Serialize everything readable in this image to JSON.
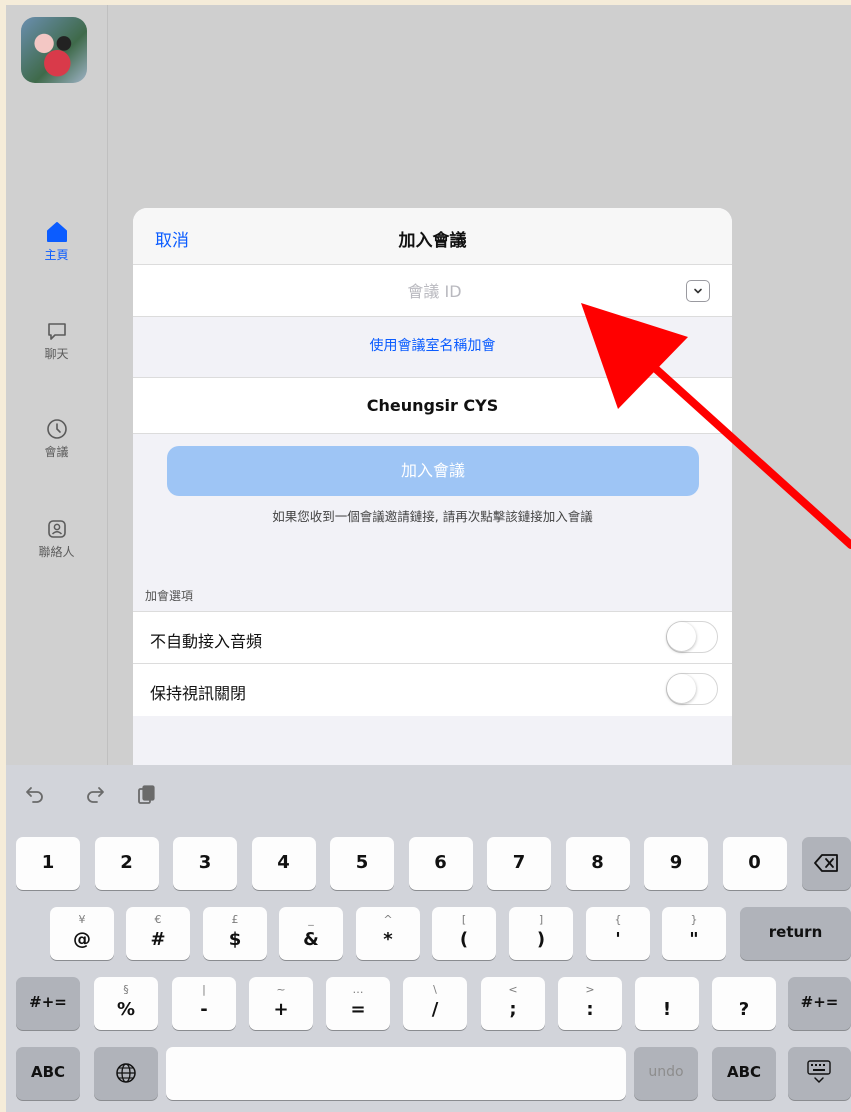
{
  "sidebar": {
    "items": [
      {
        "label": "主頁",
        "icon": "home-icon"
      },
      {
        "label": "聊天",
        "icon": "chat-bubble-icon"
      },
      {
        "label": "會議",
        "icon": "clock-icon"
      },
      {
        "label": "聯絡人",
        "icon": "contact-icon"
      }
    ]
  },
  "dialog": {
    "cancel_label": "取消",
    "title": "加入會議",
    "meeting_id_placeholder": "會議 ID",
    "meeting_id_value": "",
    "room_name_link": "使用會議室名稱加會",
    "display_name": "Cheungsir CYS",
    "join_button": "加入會議",
    "hint": "如果您收到一個會議邀請鏈接, 請再次點擊該鏈接加入會議",
    "options_label": "加會選項",
    "options": [
      {
        "label": "不自動接入音頻",
        "on": false
      },
      {
        "label": "保持視訊關閉",
        "on": false
      }
    ]
  },
  "annotation": {
    "color": "#ff0000"
  },
  "colors": {
    "accent": "#0b5cff",
    "join_button_disabled": "#9ec5f5"
  },
  "keyboard": {
    "toolbar": [
      "undo-icon",
      "redo-icon",
      "clipboard-icon"
    ],
    "row1": [
      "1",
      "2",
      "3",
      "4",
      "5",
      "6",
      "7",
      "8",
      "9",
      "0"
    ],
    "row2": [
      {
        "alt": "¥",
        "main": "@"
      },
      {
        "alt": "€",
        "main": "#"
      },
      {
        "alt": "£",
        "main": "$"
      },
      {
        "alt": "_",
        "main": "&"
      },
      {
        "alt": "^",
        "main": "*"
      },
      {
        "alt": "[",
        "main": "("
      },
      {
        "alt": "]",
        "main": ")"
      },
      {
        "alt": "{",
        "main": "'"
      },
      {
        "alt": "}",
        "main": "\""
      }
    ],
    "return_label": "return",
    "row3": [
      {
        "alt": "§",
        "main": "%"
      },
      {
        "alt": "|",
        "main": "-"
      },
      {
        "alt": "~",
        "main": "+"
      },
      {
        "alt": "…",
        "main": "="
      },
      {
        "alt": "\\",
        "main": "/"
      },
      {
        "alt": "<",
        "main": ";"
      },
      {
        "alt": ">",
        "main": ":"
      },
      {
        "alt": "",
        "main": "!"
      },
      {
        "alt": "",
        "main": "?"
      }
    ],
    "sym_label": "#+=",
    "abc_label": "ABC",
    "undo_label": "undo"
  }
}
